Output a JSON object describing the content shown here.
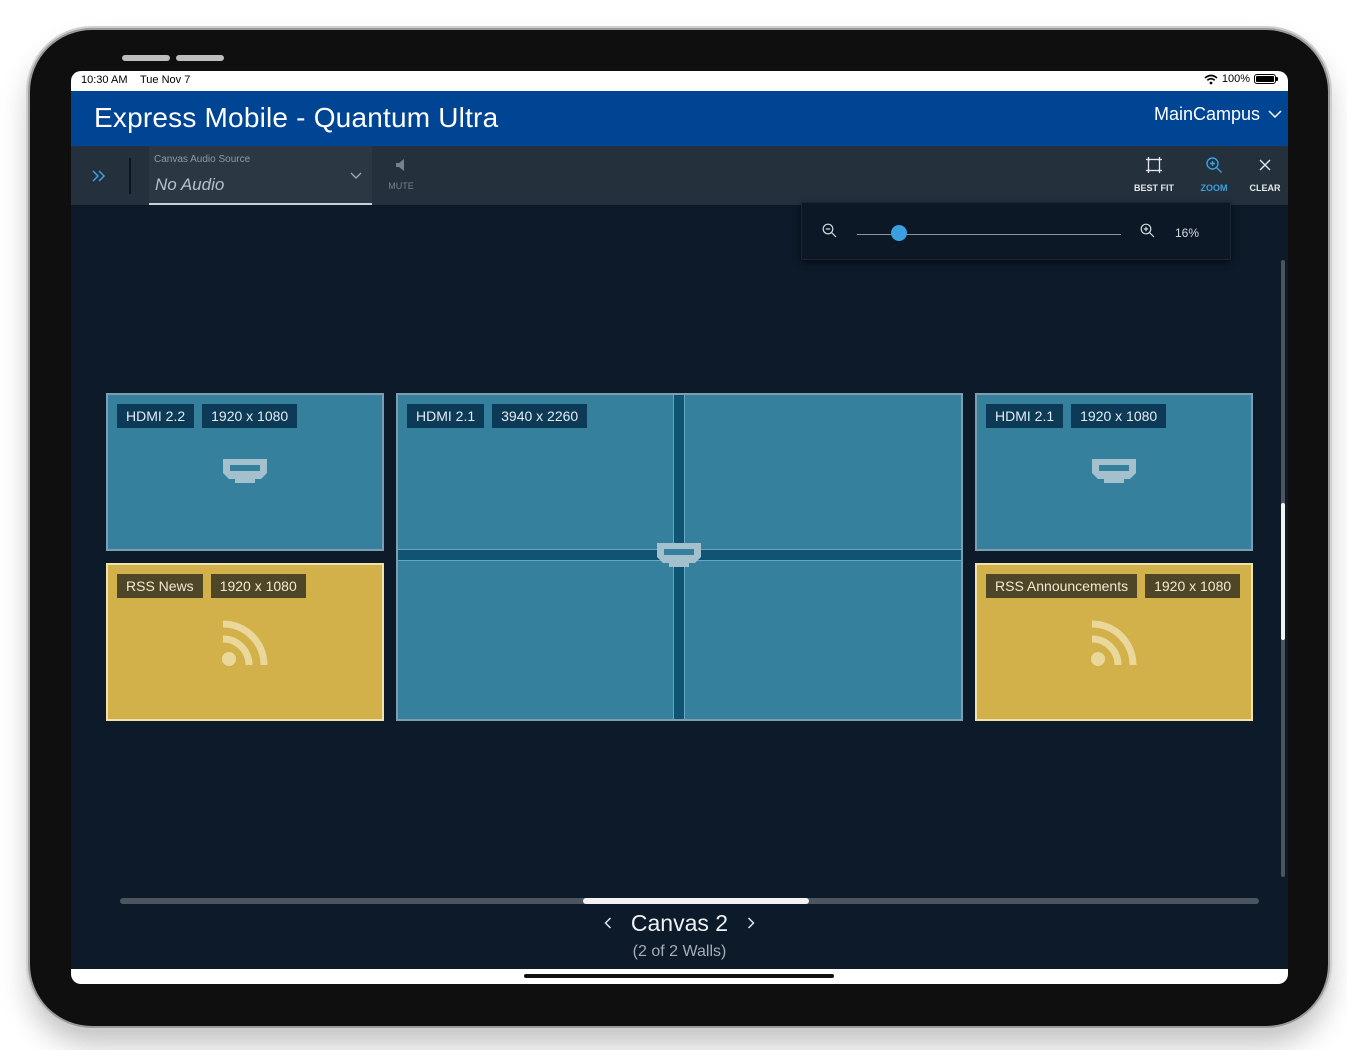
{
  "status_bar": {
    "time": "10:30 AM",
    "date": "Tue Nov 7",
    "battery": "100%"
  },
  "app": {
    "title": "Express Mobile - Quantum Ultra",
    "campus": "MainCampus"
  },
  "toolbar": {
    "audio_source_label": "Canvas Audio Source",
    "audio_source_value": "No Audio",
    "mute_label": "MUTE",
    "best_fit_label": "BEST FIT",
    "zoom_label": "ZOOM",
    "clear_label": "CLEAR"
  },
  "zoom": {
    "percent_label": "16%",
    "level": 0.16
  },
  "tiles": [
    {
      "source": "HDMI 2.2",
      "resolution": "1920 x 1080",
      "kind": "hdmi"
    },
    {
      "source": "HDMI 2.1",
      "resolution": "3940 x 2260",
      "kind": "hdmi"
    },
    {
      "source": "HDMI 2.1",
      "resolution": "1920 x 1080",
      "kind": "hdmi"
    },
    {
      "source": "RSS News",
      "resolution": "1920 x 1080",
      "kind": "rss"
    },
    {
      "source": "RSS Announcements",
      "resolution": "1920 x 1080",
      "kind": "rss"
    }
  ],
  "canvas": {
    "name": "Canvas 2",
    "walls_text": "(2 of 2 Walls)"
  },
  "colors": {
    "header": "#004494",
    "accent": "#3aa0e0",
    "hdmi_tile": "#34809d",
    "rss_tile": "#d2b04a",
    "background": "#0c1a29"
  }
}
